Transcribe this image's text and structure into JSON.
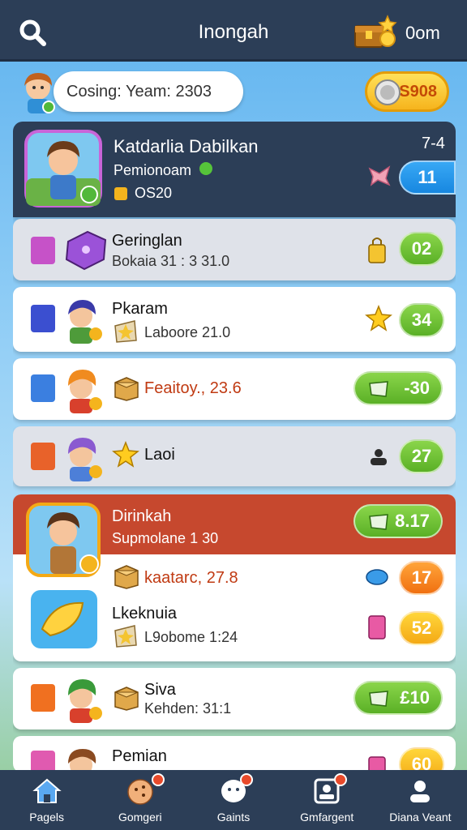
{
  "header": {
    "title": "Inongah",
    "coins": "0om"
  },
  "profile": {
    "status": "Cosing: Yeam: 2303",
    "gold": "S908"
  },
  "featured": {
    "title": "Katdarlia Dabilkan",
    "subtitle": "Pemionoam",
    "code": "OS20",
    "count": "7-4",
    "badge": "11"
  },
  "rows": [
    {
      "title": "Geringlan",
      "sub": "Bokaia 31 : 3 31.0",
      "badge": "02",
      "badge_color": "green"
    },
    {
      "title": "Pkaram",
      "sub": "Laboore 21.0",
      "badge": "34",
      "badge_color": "green"
    },
    {
      "title": "Feaitoy., 23.6",
      "sub": "",
      "badge": "-30",
      "badge_color": "green"
    },
    {
      "title": "Laoi",
      "sub": "",
      "badge": "27",
      "badge_color": "green"
    }
  ],
  "highlight": {
    "title": "Dirinkah",
    "subtitle": "Supmolane 1 30",
    "badge": "8.17",
    "line1": "kaatarc, 27.8",
    "line1_badge": "17",
    "line2_title": "Lkeknuia",
    "line2_sub": "L9obome 1:24",
    "line2_badge": "52"
  },
  "rows2": [
    {
      "title": "Siva",
      "sub": "Kehden: 31:1",
      "badge": "£10",
      "badge_color": "green"
    },
    {
      "title": "Pemian",
      "sub": "",
      "badge": "60",
      "badge_color": "yellow"
    }
  ],
  "nav": [
    {
      "label": "Pagels",
      "icon": "home-icon"
    },
    {
      "label": "Gomgeri",
      "icon": "cookie-icon"
    },
    {
      "label": "Gaints",
      "icon": "chat-icon"
    },
    {
      "label": "Gmfargent",
      "icon": "picture-icon"
    },
    {
      "label": "Diana Veant",
      "icon": "profile-icon"
    }
  ],
  "colors": {
    "header": "#2c3e57",
    "accent_green": "#5ab026",
    "accent_orange": "#f07010",
    "highlight_red": "#c6482e"
  }
}
